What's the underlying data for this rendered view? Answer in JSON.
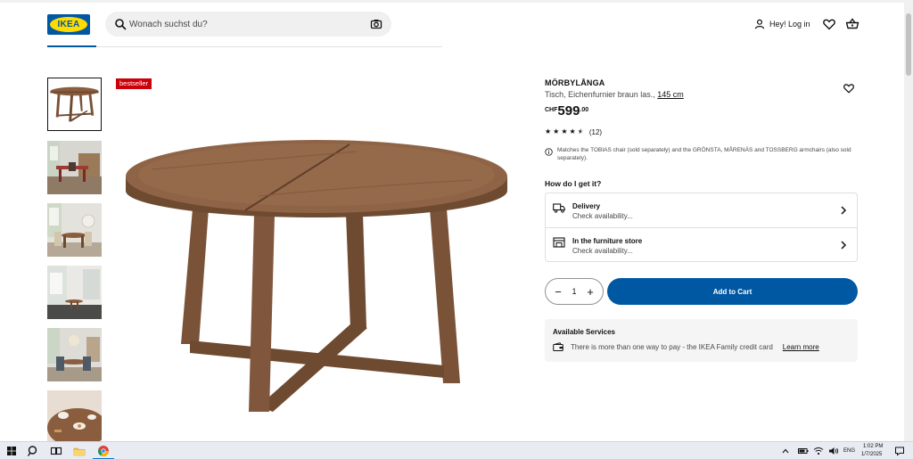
{
  "header": {
    "logo_text": "IKEA",
    "search_placeholder": "Wonach suchst du?",
    "login_label": "Hey! Log in"
  },
  "product": {
    "badge": "bestseller",
    "name": "MÖRBYLÅNGA",
    "description": "Tisch, Eichenfurnier braun las.,",
    "size": "145 cm",
    "price_currency": "CHF",
    "price_integer": "599",
    "price_decimal": ".00",
    "rating_count": "(12)",
    "rating_value": 4.5,
    "note": "Matches the TOBIAS chair (sold separately) and the GRÖNSTA, MÅRENÄS and TOSSBERG armchairs (also sold separately)."
  },
  "fulfilment": {
    "heading": "How do I get it?",
    "options": [
      {
        "title": "Delivery",
        "subtitle": "Check availability...",
        "icon": "truck-icon"
      },
      {
        "title": "In the furniture store",
        "subtitle": "Check availability...",
        "icon": "store-icon"
      }
    ]
  },
  "purchase": {
    "minus": "−",
    "quantity": "1",
    "plus": "+",
    "add_to_cart": "Add to Cart"
  },
  "services": {
    "heading": "Available Services",
    "text": "There is more than one way to pay - the IKEA Family credit card",
    "link": "Learn more"
  },
  "taskbar": {
    "lang": "ENG",
    "time": "1:02 PM",
    "date": "1/7/2025"
  },
  "colors": {
    "ikea_blue": "#0058a3",
    "ikea_yellow": "#ffdb00",
    "badge_red": "#cc0008",
    "wood": "#8a5d3f"
  }
}
